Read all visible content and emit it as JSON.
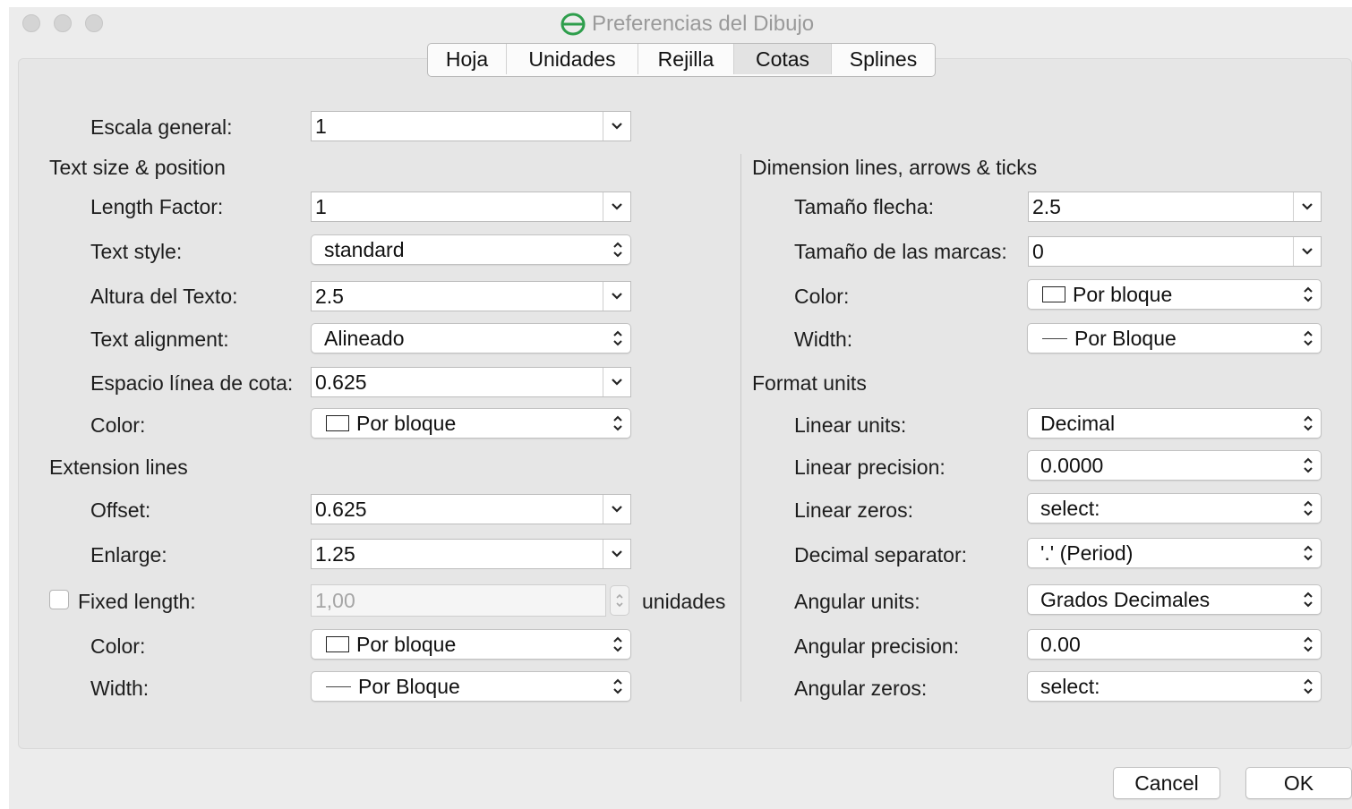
{
  "window": {
    "title": "Preferencias del Dibujo",
    "traffic_lights": [
      "close-button",
      "minimize-button",
      "zoom-button"
    ],
    "icon": "app-logo-icon"
  },
  "tabs": [
    "Hoja",
    "Unidades",
    "Rejilla",
    "Cotas",
    "Splines"
  ],
  "active_tab": "Cotas",
  "left": {
    "escala_label": "Escala general:",
    "escala_value": "1",
    "text_section": "Text size & position",
    "length_factor_label": "Length Factor:",
    "length_factor_value": "1",
    "text_style_label": "Text style:",
    "text_style_value": "standard",
    "altura_label": "Altura del Texto:",
    "altura_value": "2.5",
    "alignment_label": "Text alignment:",
    "alignment_value": "Alineado",
    "espacio_label": "Espacio línea de cota:",
    "espacio_value": "0.625",
    "color_label": "Color:",
    "color_value": "Por bloque",
    "ext_section": "Extension lines",
    "offset_label": "Offset:",
    "offset_value": "0.625",
    "enlarge_label": "Enlarge:",
    "enlarge_value": "1.25",
    "fixed_label": "Fixed length:",
    "fixed_value": "1,00",
    "fixed_unit": "unidades",
    "ext_color_label": "Color:",
    "ext_color_value": "Por bloque",
    "ext_width_label": "Width:",
    "ext_width_value": "Por Bloque"
  },
  "right": {
    "dim_section": "Dimension lines, arrows & ticks",
    "flecha_label": "Tamaño flecha:",
    "flecha_value": "2.5",
    "marcas_label": "Tamaño de las marcas:",
    "marcas_value": "0",
    "color_label": "Color:",
    "color_value": "Por bloque",
    "width_label": "Width:",
    "width_value": "Por Bloque",
    "format_section": "Format units",
    "linear_units_label": "Linear units:",
    "linear_units_value": "Decimal",
    "linear_precision_label": "Linear precision:",
    "linear_precision_value": "0.0000",
    "linear_zeros_label": "Linear zeros:",
    "linear_zeros_value": "select:",
    "decimal_sep_label": "Decimal separator:",
    "decimal_sep_value": "'.' (Period)",
    "angular_units_label": "Angular units:",
    "angular_units_value": "Grados Decimales",
    "angular_precision_label": "Angular precision:",
    "angular_precision_value": "0.00",
    "angular_zeros_label": "Angular zeros:",
    "angular_zeros_value": "select:"
  },
  "buttons": {
    "cancel": "Cancel",
    "ok": "OK"
  },
  "colors": {
    "window_bg": "#ececec",
    "panel_bg": "#e6e6e6",
    "accent": "#2e9e4c"
  }
}
